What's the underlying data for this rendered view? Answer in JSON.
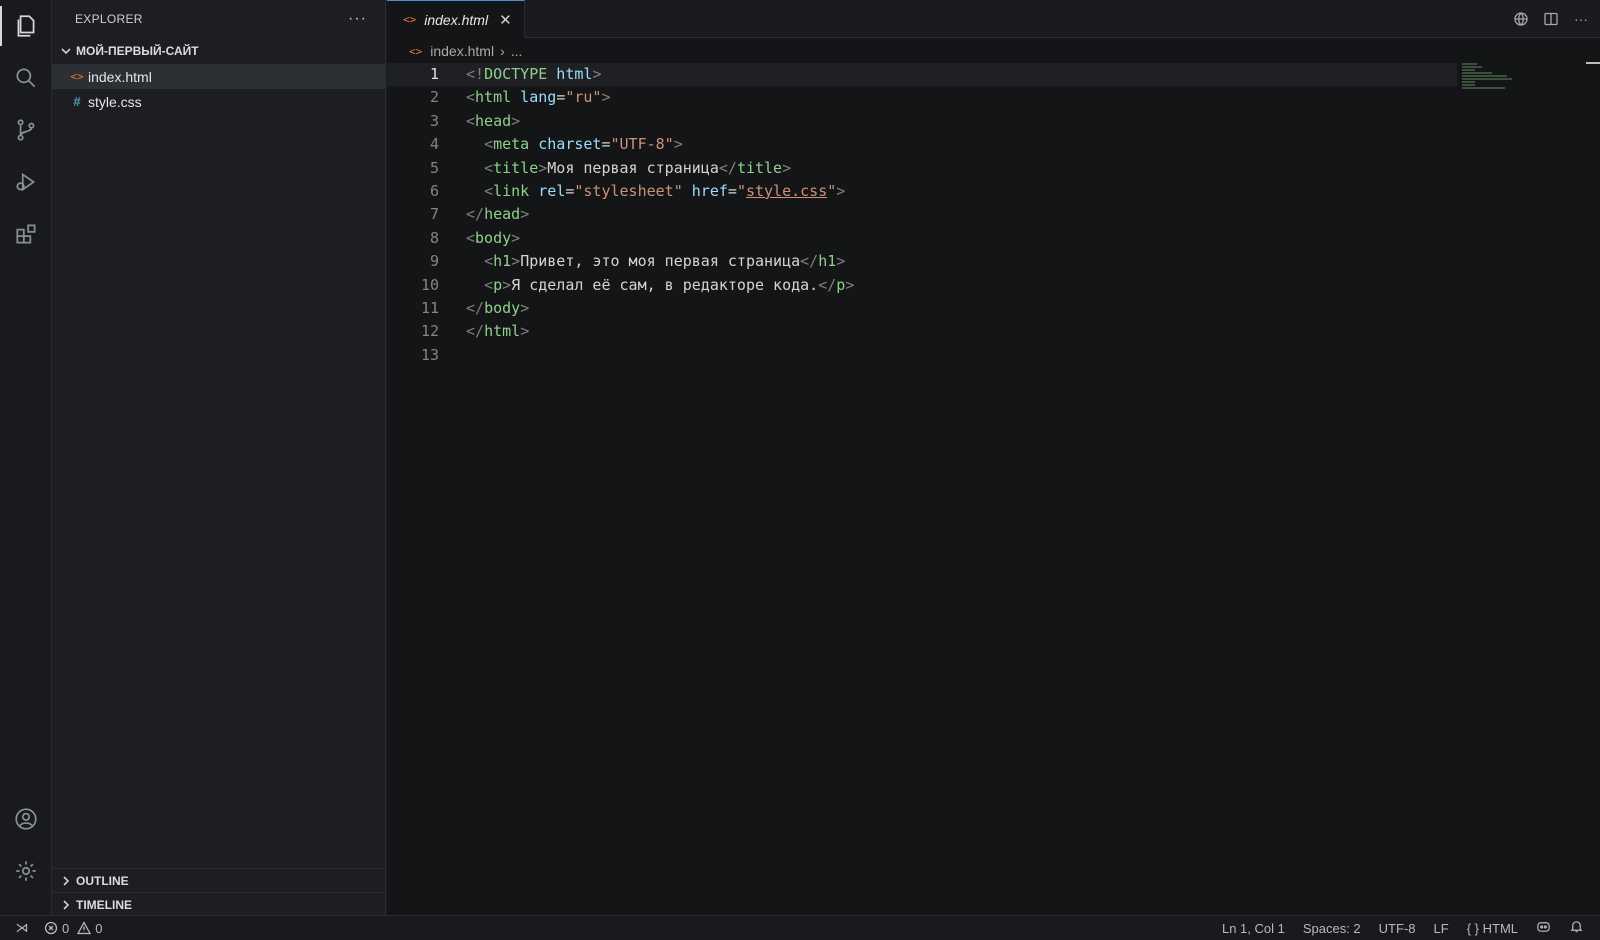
{
  "activity_bar": {
    "items": [
      "explorer-icon",
      "search-icon",
      "source-control-icon",
      "run-debug-icon",
      "extensions-icon"
    ],
    "bottom": [
      "account-icon",
      "settings-gear-icon"
    ]
  },
  "sidebar": {
    "title": "EXPLORER",
    "folder": "МОЙ-ПЕРВЫЙ-САЙТ",
    "files": [
      {
        "name": "index.html",
        "icon": "<>",
        "selected": true
      },
      {
        "name": "style.css",
        "icon": "#",
        "selected": false
      }
    ],
    "sections": [
      "OUTLINE",
      "TIMELINE"
    ]
  },
  "editor": {
    "tab": {
      "icon": "<>",
      "label": "index.html",
      "close": "✕"
    },
    "breadcrumb": {
      "file": "index.html",
      "rest": "..."
    },
    "current_line": 1,
    "lines": [
      {
        "n": "1",
        "parts": [
          [
            "punc",
            "<!"
          ],
          [
            "tag",
            "DOCTYPE"
          ],
          [
            "attr",
            " html"
          ],
          [
            "punc",
            ">"
          ]
        ]
      },
      {
        "n": "2",
        "parts": [
          [
            "punc",
            "<"
          ],
          [
            "tag",
            "html"
          ],
          [
            "attr",
            " lang"
          ],
          [
            "text",
            "="
          ],
          [
            "val",
            "\"ru\""
          ],
          [
            "punc",
            ">"
          ]
        ]
      },
      {
        "n": "3",
        "parts": [
          [
            "punc",
            "<"
          ],
          [
            "tag",
            "head"
          ],
          [
            "punc",
            ">"
          ]
        ]
      },
      {
        "n": "4",
        "parts": [
          [
            "text",
            "  "
          ],
          [
            "punc",
            "<"
          ],
          [
            "tag",
            "meta"
          ],
          [
            "attr",
            " charset"
          ],
          [
            "text",
            "="
          ],
          [
            "val",
            "\"UTF-8\""
          ],
          [
            "punc",
            ">"
          ]
        ]
      },
      {
        "n": "5",
        "parts": [
          [
            "text",
            "  "
          ],
          [
            "punc",
            "<"
          ],
          [
            "tag",
            "title"
          ],
          [
            "punc",
            ">"
          ],
          [
            "text",
            "Моя первая страница"
          ],
          [
            "punc",
            "</"
          ],
          [
            "tag",
            "title"
          ],
          [
            "punc",
            ">"
          ]
        ]
      },
      {
        "n": "6",
        "parts": [
          [
            "text",
            "  "
          ],
          [
            "punc",
            "<"
          ],
          [
            "tag",
            "link"
          ],
          [
            "attr",
            " rel"
          ],
          [
            "text",
            "="
          ],
          [
            "val",
            "\"stylesheet\""
          ],
          [
            "attr",
            " href"
          ],
          [
            "text",
            "="
          ],
          [
            "val",
            "\""
          ],
          [
            "link",
            "style.css"
          ],
          [
            "val",
            "\""
          ],
          [
            "punc",
            ">"
          ]
        ]
      },
      {
        "n": "7",
        "parts": [
          [
            "punc",
            "</"
          ],
          [
            "tag",
            "head"
          ],
          [
            "punc",
            ">"
          ]
        ]
      },
      {
        "n": "8",
        "parts": [
          [
            "punc",
            "<"
          ],
          [
            "tag",
            "body"
          ],
          [
            "punc",
            ">"
          ]
        ]
      },
      {
        "n": "9",
        "parts": [
          [
            "text",
            "  "
          ],
          [
            "punc",
            "<"
          ],
          [
            "tag",
            "h1"
          ],
          [
            "punc",
            ">"
          ],
          [
            "text",
            "Привет, это моя первая страница"
          ],
          [
            "punc",
            "</"
          ],
          [
            "tag",
            "h1"
          ],
          [
            "punc",
            ">"
          ]
        ]
      },
      {
        "n": "10",
        "parts": [
          [
            "text",
            "  "
          ],
          [
            "punc",
            "<"
          ],
          [
            "tag",
            "p"
          ],
          [
            "punc",
            ">"
          ],
          [
            "text",
            "Я сделал её сам, в редакторе кода."
          ],
          [
            "punc",
            "</"
          ],
          [
            "tag",
            "p"
          ],
          [
            "punc",
            ">"
          ]
        ]
      },
      {
        "n": "11",
        "parts": [
          [
            "punc",
            "</"
          ],
          [
            "tag",
            "body"
          ],
          [
            "punc",
            ">"
          ]
        ]
      },
      {
        "n": "12",
        "parts": [
          [
            "punc",
            "</"
          ],
          [
            "tag",
            "html"
          ],
          [
            "punc",
            ">"
          ]
        ]
      },
      {
        "n": "13",
        "parts": []
      }
    ]
  },
  "statusbar": {
    "errors": "0",
    "warnings": "0",
    "position": "Ln 1, Col 1",
    "spaces": "Spaces: 2",
    "encoding": "UTF-8",
    "eol": "LF",
    "language_icon": "{ }",
    "language": "HTML"
  },
  "colors": {
    "accent": "#4a8fd6",
    "html_icon": "#e8793b",
    "css_icon": "#519aba",
    "tag": "#8fd18b",
    "attr": "#9cdcfe",
    "string": "#ce9178"
  }
}
